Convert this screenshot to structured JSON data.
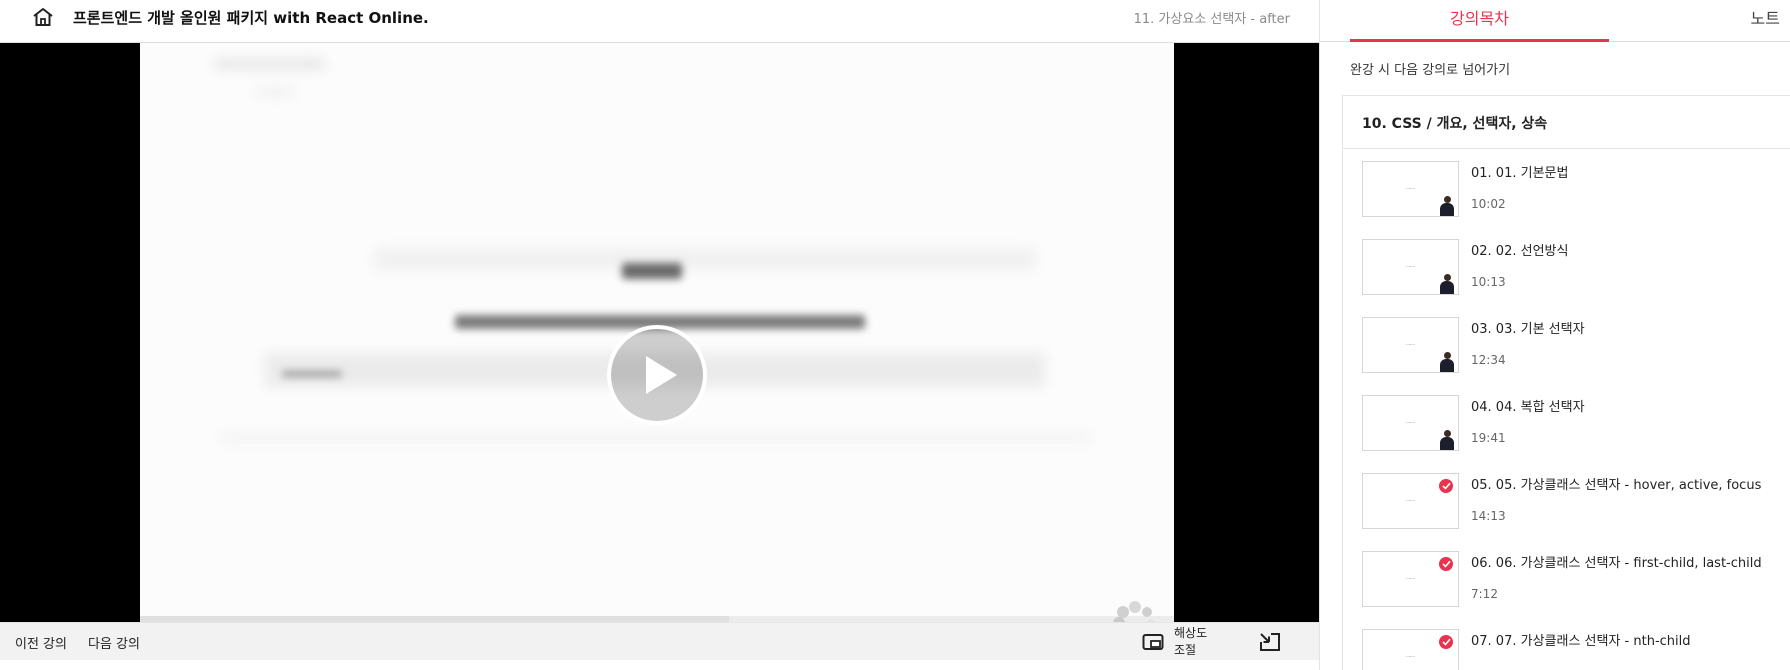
{
  "header": {
    "course_title": "프론트엔드 개발 올인원 패키지 with React Online.",
    "current_lecture": "11. 가상요소 선택자 - after"
  },
  "player": {
    "prev_label": "이전 강의",
    "next_label": "다음 강의",
    "quality_label": "해상도 조절",
    "progress_buffered": 0.57
  },
  "sidebar": {
    "tabs": [
      {
        "label": "강의목차",
        "active": true
      },
      {
        "label": "노트",
        "active": false
      }
    ],
    "autoplay_label": "완강 시 다음 강의로 넘어가기",
    "section_title": "10. CSS / 개요, 선택자, 상속",
    "lessons": [
      {
        "title": "01. 01. 기본문법",
        "duration": "10:02",
        "completed": false
      },
      {
        "title": "02. 02. 선언방식",
        "duration": "10:13",
        "completed": false
      },
      {
        "title": "03. 03. 기본 선택자",
        "duration": "12:34",
        "completed": false
      },
      {
        "title": "04. 04. 복합 선택자",
        "duration": "19:41",
        "completed": false
      },
      {
        "title": "05. 05. 가상클래스 선택자 - hover, active, focus",
        "duration": "14:13",
        "completed": true
      },
      {
        "title": "06. 06. 가상클래스 선택자 - first-child, last-child",
        "duration": "7:12",
        "completed": true
      },
      {
        "title": "07. 07. 가상클래스 선택자 - nth-child",
        "duration": "",
        "completed": true
      }
    ]
  },
  "colors": {
    "accent": "#e8344e",
    "video_bg": "#000000",
    "control_bar": "#f2f2f2"
  }
}
